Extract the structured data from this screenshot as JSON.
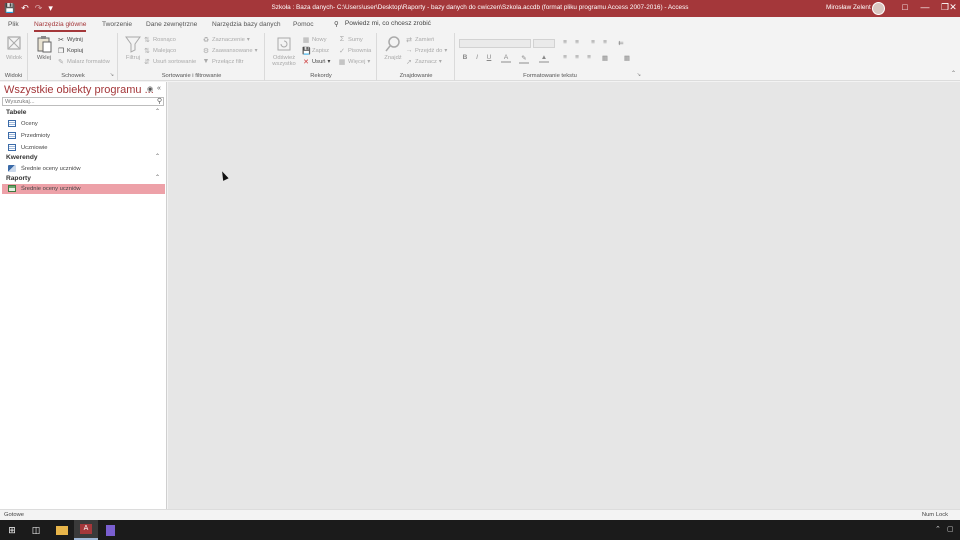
{
  "titlebar": {
    "title": "Szkoła : Baza danych- C:\\Users\\user\\Desktop\\Raporty - bazy danych do cwiczen\\Szkola.accdb (format pliku programu Access 2007-2016)  -  Access",
    "user": "Mirosław Zelent",
    "qat_icons": [
      "save-icon",
      "undo-icon",
      "redo-icon",
      "customize-qat-icon"
    ],
    "window_controls": [
      "ribbon-display-icon",
      "minimize-icon",
      "restore-icon",
      "close-icon"
    ]
  },
  "tabs": [
    {
      "label": "Plik",
      "active": false
    },
    {
      "label": "Narzędzia główne",
      "active": true
    },
    {
      "label": "Tworzenie",
      "active": false
    },
    {
      "label": "Dane zewnętrzne",
      "active": false
    },
    {
      "label": "Narzędzia bazy danych",
      "active": false
    },
    {
      "label": "Pomoc",
      "active": false
    }
  ],
  "tell_me": {
    "placeholder": "Powiedz mi, co chcesz zrobić",
    "icon": "lightbulb-icon"
  },
  "ribbon": {
    "views": {
      "group_label": "Widoki",
      "view_label": "Widok"
    },
    "clipboard": {
      "group_label": "Schowek",
      "paste_label": "Wklej",
      "cut_label": "Wytnij",
      "copy_label": "Kopiuj",
      "format_painter_label": "Malarz formatów"
    },
    "sort_filter": {
      "group_label": "Sortowanie i filtrowanie",
      "filter_label": "Filtruj",
      "ascending_label": "Rosnąco",
      "descending_label": "Malejąco",
      "remove_sort_label": "Usuń sortowanie",
      "selection_label": "Zaznaczenie",
      "advanced_label": "Zaawansowane",
      "toggle_filter_label": "Przełącz filtr"
    },
    "records": {
      "group_label": "Rekordy",
      "refresh_label": "Odśwież wszystko",
      "new_label": "Nowy",
      "save_label": "Zapisz",
      "delete_label": "Usuń",
      "totals_label": "Sumy",
      "spelling_label": "Pisownia",
      "more_label": "Więcej"
    },
    "find": {
      "group_label": "Znajdowanie",
      "find_label": "Znajdź",
      "replace_label": "Zamień",
      "goto_label": "Przejdź do",
      "select_label": "Zaznacz"
    },
    "text_format": {
      "group_label": "Formatowanie tekstu",
      "bold": "B",
      "italic": "I",
      "underline": "U"
    }
  },
  "nav": {
    "title": "Wszystkie obiekty programu ...",
    "search_placeholder": "Wyszukaj...",
    "sections": [
      {
        "label": "Tabele",
        "items": [
          "Oceny",
          "Przedmioty",
          "Uczniowie"
        ]
      },
      {
        "label": "Kwerendy",
        "items": [
          "Średnie oceny uczniów"
        ]
      },
      {
        "label": "Raporty",
        "items": [
          "Średnie oceny uczniów"
        ]
      }
    ],
    "selected": "Raporty/Średnie oceny uczniów"
  },
  "status": {
    "left": "Gotowe",
    "right": "Num Lock"
  },
  "taskbar": {
    "apps": [
      "start-icon",
      "task-view-icon",
      "file-explorer-icon",
      "access-icon",
      "notepad-icon"
    ],
    "active_app": "access-icon"
  }
}
